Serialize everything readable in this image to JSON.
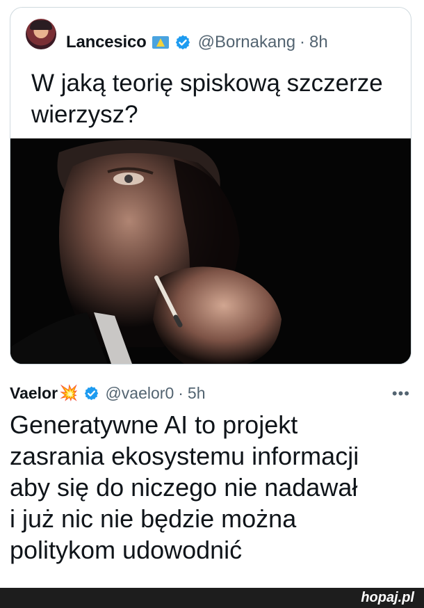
{
  "quoted_tweet": {
    "author_name": "Lancesico",
    "handle": "@Bornakang",
    "separator": "·",
    "time": "8h",
    "text": "W jaką teorię spiskową szczerze wierzysz?",
    "icons": [
      "avatar",
      "flag-icon",
      "verified-badge-icon"
    ],
    "image_description_label": "man-smoking-photo"
  },
  "reply_tweet": {
    "author_name": "Vaelor",
    "emoji": "💥",
    "handle": "@vaelor0",
    "separator": "·",
    "time": "5h",
    "more_label": "•••",
    "text_lines": [
      "Generatywne AI to projekt",
      "zasrania ekosystemu informacji",
      "aby się do niczego nie nadawał",
      "i już nic nie będzie można",
      "politykom udowodnić"
    ]
  },
  "footer": {
    "watermark": "hopaj.pl"
  },
  "colors": {
    "verified": "#1d9bf0",
    "secondary_text": "#536471",
    "border": "#cfd9de"
  }
}
